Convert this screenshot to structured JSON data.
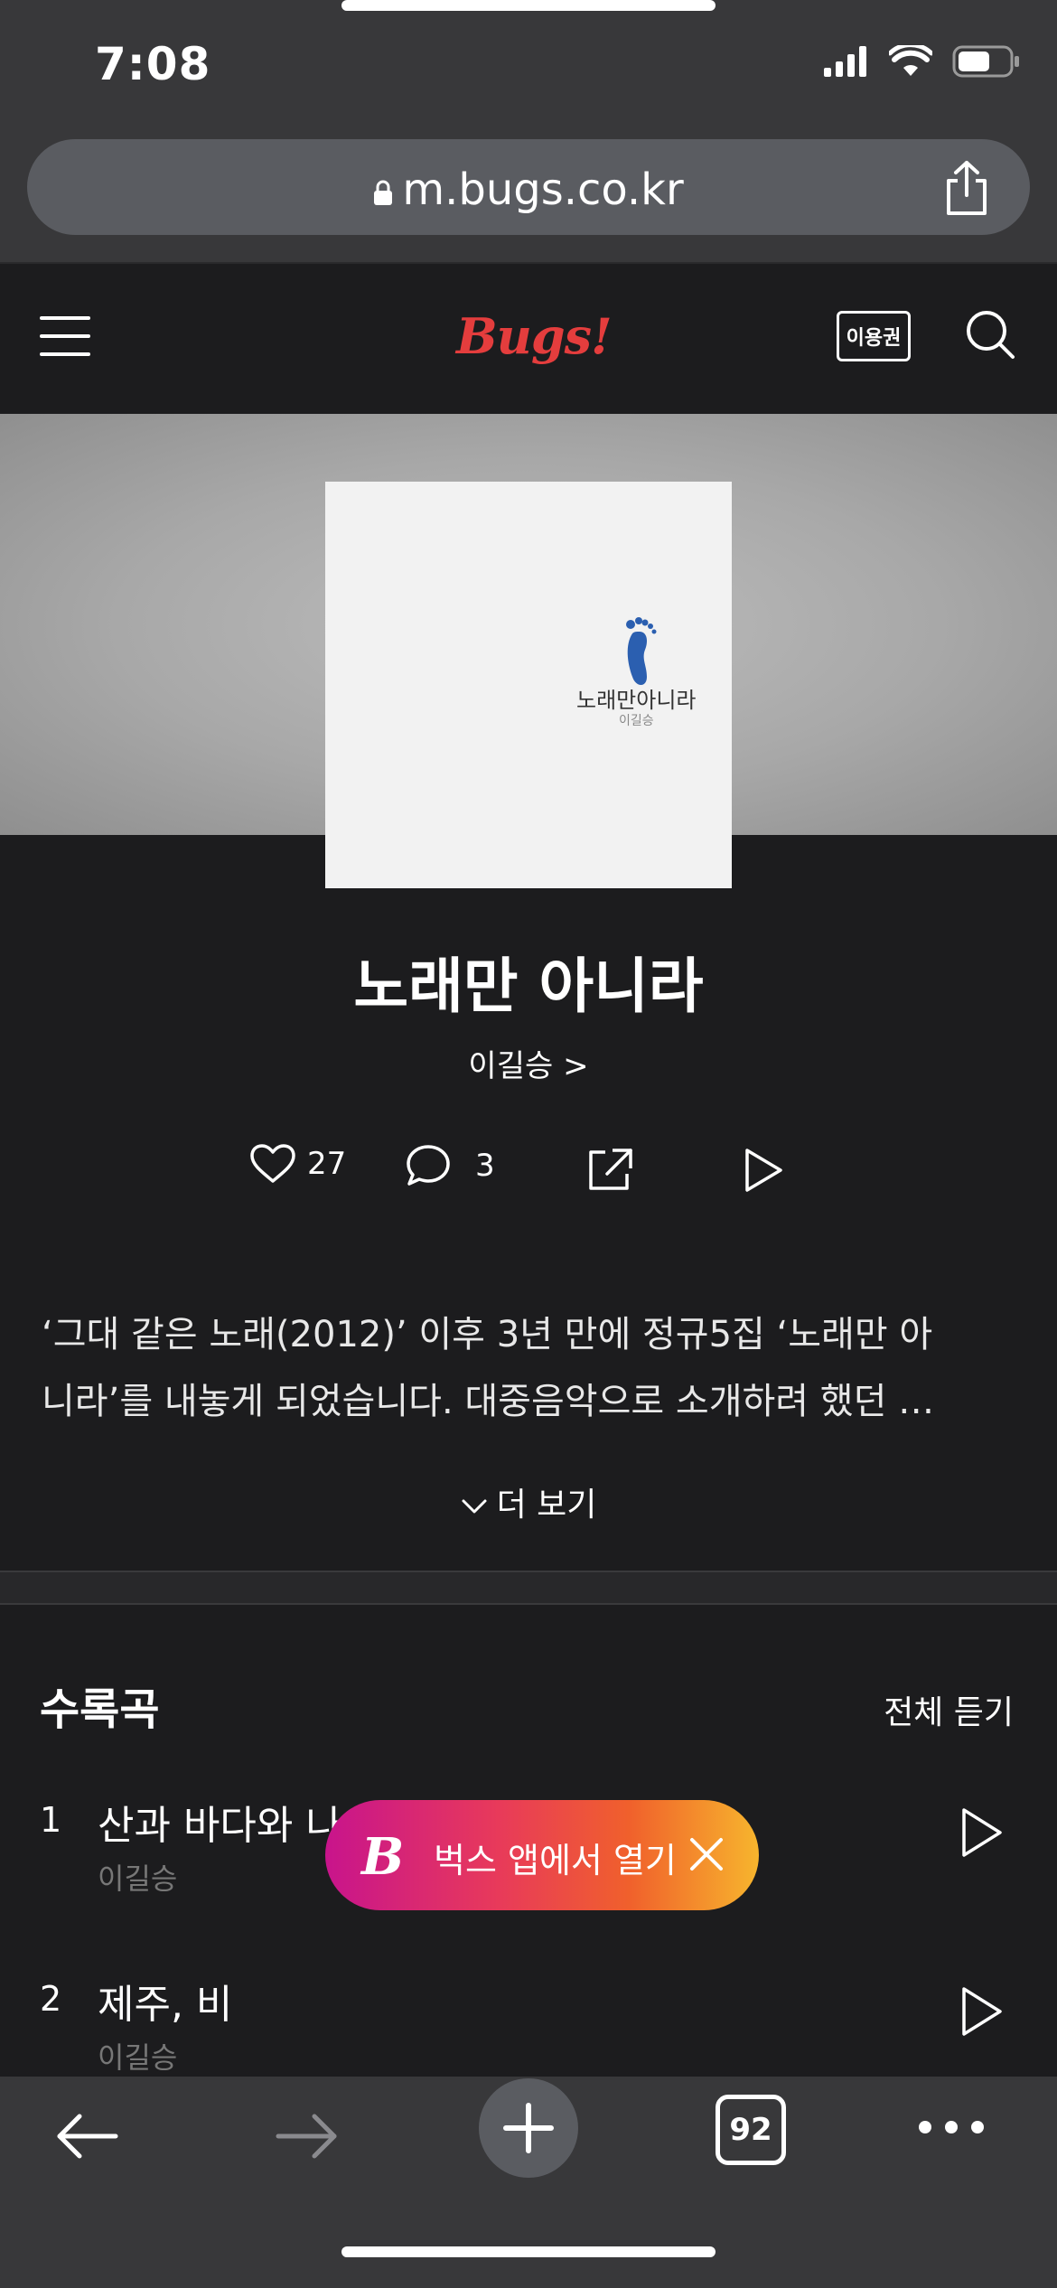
{
  "status": {
    "time": "7:08"
  },
  "browser": {
    "url": "m.bugs.co.kr",
    "tab_count": "92"
  },
  "header": {
    "logo": "Bugs!",
    "ticket_label": "이용권"
  },
  "cover": {
    "title": "노래만아니라",
    "artist": "이길승"
  },
  "album": {
    "title": "노래만 아니라",
    "artist": "이길승 >",
    "likes": "27",
    "comments": "3"
  },
  "description": {
    "line1": "‘그대 같은 노래(2012)’ 이후 3년 만에 정규5집 ‘노래만 아",
    "line2": "니라’를 내놓게 되었습니다. 대중음악으로 소개하려 했던 …",
    "more_label": "더 보기"
  },
  "tracklist": {
    "title": "수록곡",
    "play_all": "전체 듣기",
    "tracks": [
      {
        "num": "1",
        "title": "산과 바다와 나",
        "artist": "이길승"
      },
      {
        "num": "2",
        "title": "제주, 비",
        "artist": "이길승"
      }
    ]
  },
  "app_banner": {
    "logo": "B",
    "text": "벅스 앱에서 열기"
  },
  "colors": {
    "brand": "#e43d3d",
    "banner_start": "#c8148c",
    "banner_end": "#f7b52d"
  }
}
